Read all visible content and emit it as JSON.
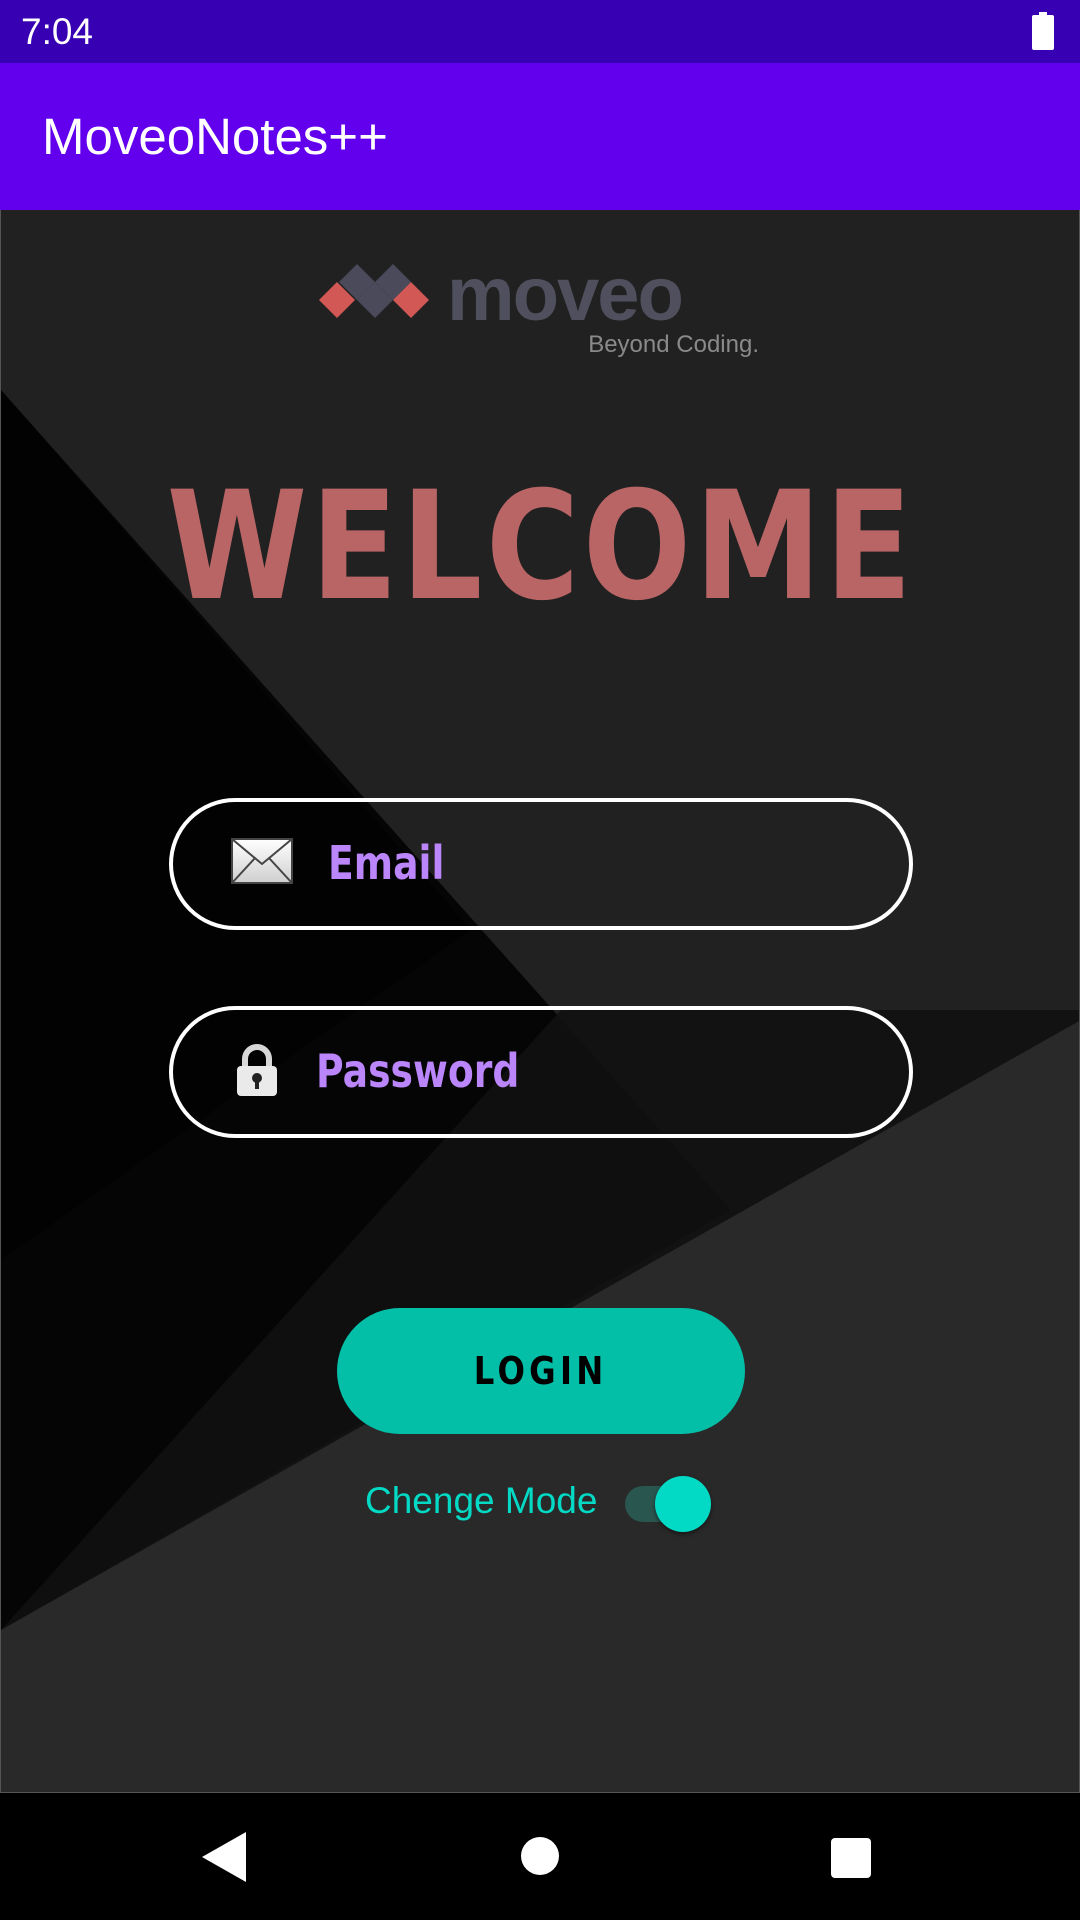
{
  "status_bar": {
    "time": "7:04",
    "battery_icon": "battery-full-icon"
  },
  "app_bar": {
    "title": "MoveoNotes++"
  },
  "logo": {
    "wordmark": "moveo",
    "tagline": "Beyond Coding."
  },
  "welcome": {
    "heading": "WELCOME",
    "color": "#b96565"
  },
  "form": {
    "email": {
      "icon": "envelope-icon",
      "placeholder": "Email"
    },
    "password": {
      "icon": "lock-icon",
      "placeholder": "Password"
    },
    "login_label": "LOGIN",
    "mode_label": "Chenge Mode",
    "mode_toggle_on": true
  },
  "colors": {
    "status_bar": "#3700b3",
    "app_bar": "#6200ee",
    "accent": "#03dac5",
    "button": "#03bfa8",
    "placeholder": "#bb86fc"
  },
  "nav_bar": {
    "back_icon": "back-triangle-icon",
    "home_icon": "home-circle-icon",
    "recents_icon": "recents-square-icon"
  }
}
